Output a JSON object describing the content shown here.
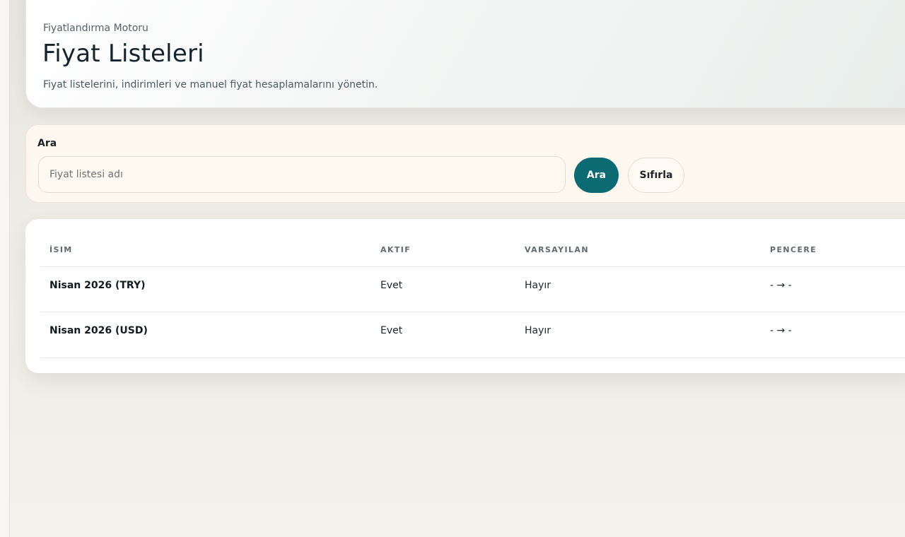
{
  "header": {
    "eyebrow": "Fiyatlandırma Motoru",
    "title": "Fiyat Listeleri",
    "description": "Fiyat listelerini, indirimleri ve manuel fiyat hesaplamalarını yönetin."
  },
  "search": {
    "label": "Ara",
    "placeholder": "Fiyat listesi adı",
    "value": "",
    "search_button": "Ara",
    "reset_button": "Sıfırla"
  },
  "table": {
    "columns": [
      "İsim",
      "Aktif",
      "Varsayılan",
      "Pencere"
    ],
    "rows": [
      {
        "name": "Nisan 2026 (TRY)",
        "active": "Evet",
        "default": "Hayır",
        "window": "- → -"
      },
      {
        "name": "Nisan 2026 (USD)",
        "active": "Evet",
        "default": "Hayır",
        "window": "- → -"
      }
    ]
  },
  "colors": {
    "accent": "#0c6b72",
    "search_card_bg": "#fff8f1"
  }
}
